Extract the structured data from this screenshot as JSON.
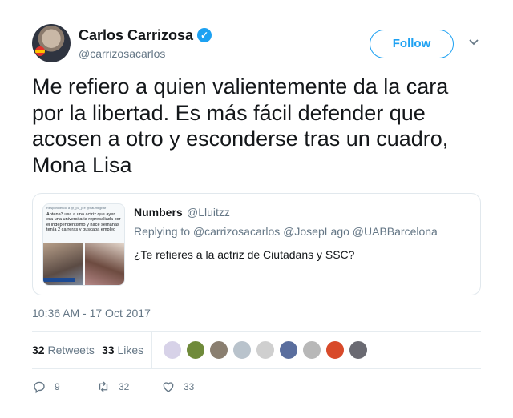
{
  "author": {
    "name": "Carlos Carrizosa",
    "handle": "@carrizosacarlos",
    "verified_icon": "verified-badge-icon"
  },
  "follow_label": "Follow",
  "tweet_text": "Me refiero a quien valientemente da la cara por la libertad. Es más fácil defender que acosen a otro y esconderse tras un cuadro, Mona Lisa",
  "quote": {
    "name": "Numbers",
    "handle": "@Lluitzz",
    "reply_prefix": "Replying to",
    "reply_mentions": [
      "@carrizosacarlos",
      "@JosepLago",
      "@UABBarcelona"
    ],
    "body": "¿Te refieres a la actriz de Ciutadans y SSC?",
    "thumbnail": {
      "header": "Respondiendo a @_p1_p e @naumegbar",
      "text": "Antena3 usa a una actriz que ayer era una universitaria represaliada por el independentismo y hace semanas tenía 2 carreras y buscaba empleo"
    }
  },
  "timestamp": "10:36 AM - 17 Oct 2017",
  "stats": {
    "retweets_count": "32",
    "retweets_label": "Retweets",
    "likes_count": "33",
    "likes_label": "Likes"
  },
  "liker_avatar_colors": [
    "#d7d2e8",
    "#6f8a3a",
    "#8a7f70",
    "#b9c3cc",
    "#cfcfcf",
    "#5a6e9e",
    "#b8b8b8",
    "#d84a2a",
    "#6a6a72"
  ],
  "actions": {
    "reply_count": "9",
    "retweet_count": "32",
    "like_count": "33"
  },
  "colors": {
    "accent": "#1da1f2",
    "secondary_text": "#657786",
    "primary_text": "#14171a",
    "border": "#e1e8ed"
  }
}
